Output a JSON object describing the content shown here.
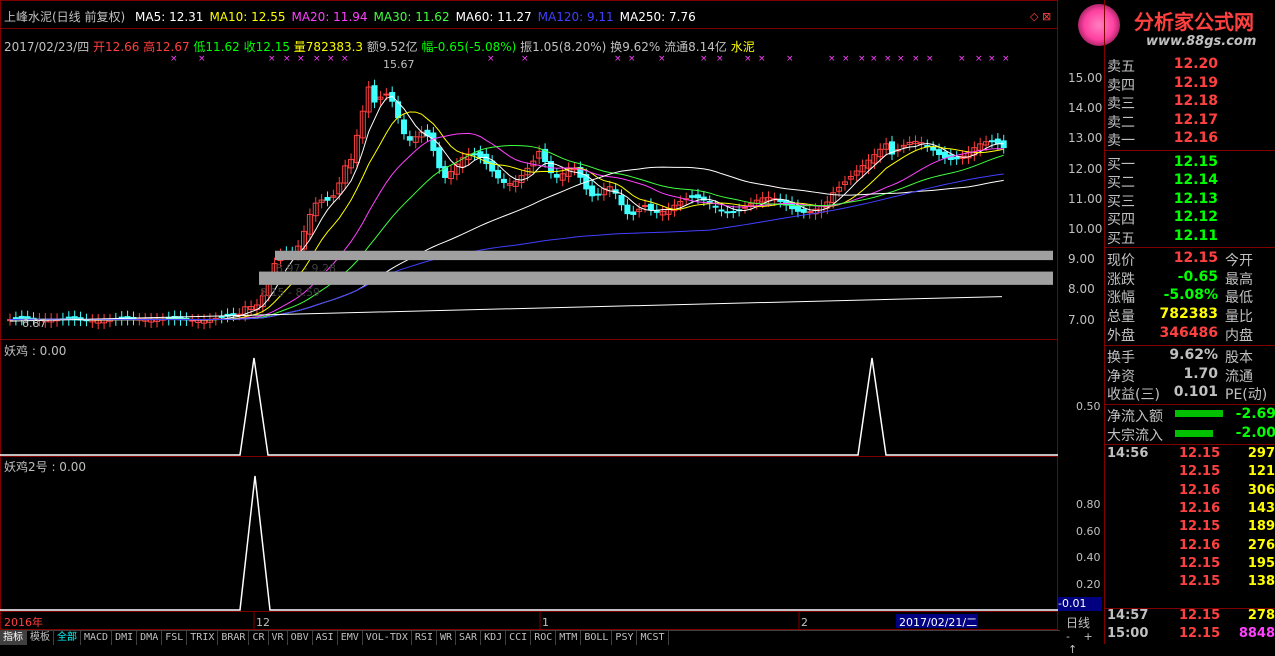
{
  "header": {
    "title": "上峰水泥(日线 前复权)",
    "ma": [
      {
        "label": "MA5: 12.31",
        "color": "#ffffff"
      },
      {
        "label": "MA10: 12.55",
        "color": "#ffff00"
      },
      {
        "label": "MA20: 11.94",
        "color": "#ff40ff"
      },
      {
        "label": "MA30: 11.62",
        "color": "#40ff40"
      },
      {
        "label": "MA60: 11.27",
        "color": "#ffffff"
      },
      {
        "label": "MA120: 9.11",
        "color": "#4040ff"
      },
      {
        "label": "MA250: 7.76",
        "color": "#ffffff"
      }
    ],
    "info_date": "2017/02/23/四",
    "info_open": "开12.66",
    "info_high": "高12.67",
    "info_low": "低11.62",
    "info_close": "收12.15",
    "info_vol": "量782383.3",
    "info_amt": "额9.52亿",
    "info_chg": "幅-0.65(-5.08%)",
    "info_amp": "振1.05(8.20%)",
    "info_turn": "换9.62%",
    "info_float": "流通8.14亿",
    "info_sector": "水泥"
  },
  "annotations": {
    "peak": "15.67",
    "low": "6.87",
    "band1": "8.97 - 9.28",
    "band2": "8.15 - 8.59"
  },
  "price_axis": [
    "15.00",
    "14.00",
    "13.00",
    "12.00",
    "11.00",
    "10.00",
    "9.00",
    "8.00",
    "7.00"
  ],
  "ind1": {
    "label": "妖鸡 : 0.00",
    "axis": "0.50"
  },
  "ind2": {
    "label": "妖鸡2号 : 0.00",
    "axis": [
      "0.80",
      "0.60",
      "0.40",
      "0.20"
    ],
    "readout": "-0.01"
  },
  "time_axis": {
    "start": "2016年",
    "m12": "12",
    "m1": "1",
    "m2": "2",
    "cursor": "2017/02/21/二",
    "period": "日线"
  },
  "logo": {
    "text": "分析家公式网",
    "url": "www.88gs.com"
  },
  "orderbook": {
    "asks": [
      {
        "l": "卖五",
        "v": "12.20"
      },
      {
        "l": "卖四",
        "v": "12.19"
      },
      {
        "l": "卖三",
        "v": "12.18"
      },
      {
        "l": "卖二",
        "v": "12.17"
      },
      {
        "l": "卖一",
        "v": "12.16"
      }
    ],
    "bids": [
      {
        "l": "买一",
        "v": "12.15"
      },
      {
        "l": "买二",
        "v": "12.14"
      },
      {
        "l": "买三",
        "v": "12.13"
      },
      {
        "l": "买四",
        "v": "12.12"
      },
      {
        "l": "买五",
        "v": "12.11"
      }
    ]
  },
  "quote": [
    {
      "l": "现价",
      "v": "12.15",
      "r": "今开",
      "c": "#ff4040"
    },
    {
      "l": "涨跌",
      "v": "-0.65",
      "r": "最高",
      "c": "#00ff00"
    },
    {
      "l": "涨幅",
      "v": "-5.08%",
      "r": "最低",
      "c": "#00ff00"
    },
    {
      "l": "总量",
      "v": "782383",
      "r": "量比",
      "c": "#ffff00"
    },
    {
      "l": "外盘",
      "v": "346486",
      "r": "内盘",
      "c": "#ff4040"
    }
  ],
  "quote2": [
    {
      "l": "换手",
      "v": "9.62%",
      "r": "股本",
      "c": "#c0c0c0"
    },
    {
      "l": "净资",
      "v": "1.70",
      "r": "流通",
      "c": "#c0c0c0"
    },
    {
      "l": "收益(三)",
      "v": "0.101",
      "r": "PE(动)",
      "c": "#c0c0c0"
    }
  ],
  "flows": [
    {
      "l": "净流入额",
      "v": "-2.69"
    },
    {
      "l": "大宗流入",
      "v": "-2.00"
    }
  ],
  "ticks": [
    {
      "t": "14:56",
      "p": "12.15",
      "q": "297"
    },
    {
      "t": "",
      "p": "12.15",
      "q": "121"
    },
    {
      "t": "",
      "p": "12.16",
      "q": "306"
    },
    {
      "t": "",
      "p": "12.16",
      "q": "143"
    },
    {
      "t": "",
      "p": "12.15",
      "q": "189"
    },
    {
      "t": "",
      "p": "12.16",
      "q": "276"
    },
    {
      "t": "",
      "p": "12.15",
      "q": "195"
    },
    {
      "t": "",
      "p": "12.15",
      "q": "138"
    },
    {
      "t": "14:57",
      "p": "12.15",
      "q": "278"
    },
    {
      "t": "15:00",
      "p": "12.15",
      "q": "8848"
    }
  ],
  "tabs": [
    "指标",
    "模板",
    "全部",
    "MACD",
    "DMI",
    "DMA",
    "FSL",
    "TRIX",
    "BRAR",
    "CR",
    "VR",
    "OBV",
    "ASI",
    "EMV",
    "VOL-TDX",
    "RSI",
    "WR",
    "SAR",
    "KDJ",
    "CCI",
    "ROC",
    "MTM",
    "BOLL",
    "PSY",
    "MCST"
  ],
  "nav": [
    "-",
    "+",
    "↑"
  ],
  "colors": {
    "up": "#ff4040",
    "down": "#40ffff",
    "grid": "#800000"
  }
}
